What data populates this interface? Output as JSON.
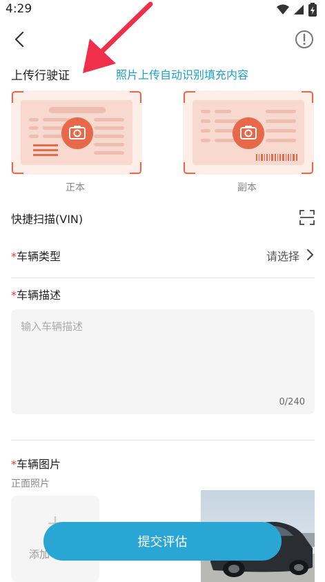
{
  "status": {
    "time": "4:29"
  },
  "license": {
    "title": "上传行驶证",
    "hint": "照片上传自动识别填充内容",
    "front_label": "正本",
    "back_label": "副本"
  },
  "vin": {
    "label": "快捷扫描(VIN)"
  },
  "vehicle_type": {
    "required_mark": "*",
    "label": "车辆类型",
    "value": "请选择"
  },
  "description": {
    "required_mark": "*",
    "label": "车辆描述",
    "placeholder": "输入车辆描述",
    "counter": "0/240"
  },
  "photos": {
    "required_mark": "*",
    "label": "车辆图片",
    "front_label": "正面照片",
    "add_label": "添加"
  },
  "submit": {
    "label": "提交评估"
  },
  "colors": {
    "accent": "#2aa6d4",
    "hint": "#1aa0c8",
    "camera": "#e8684a",
    "required": "#e53935"
  }
}
